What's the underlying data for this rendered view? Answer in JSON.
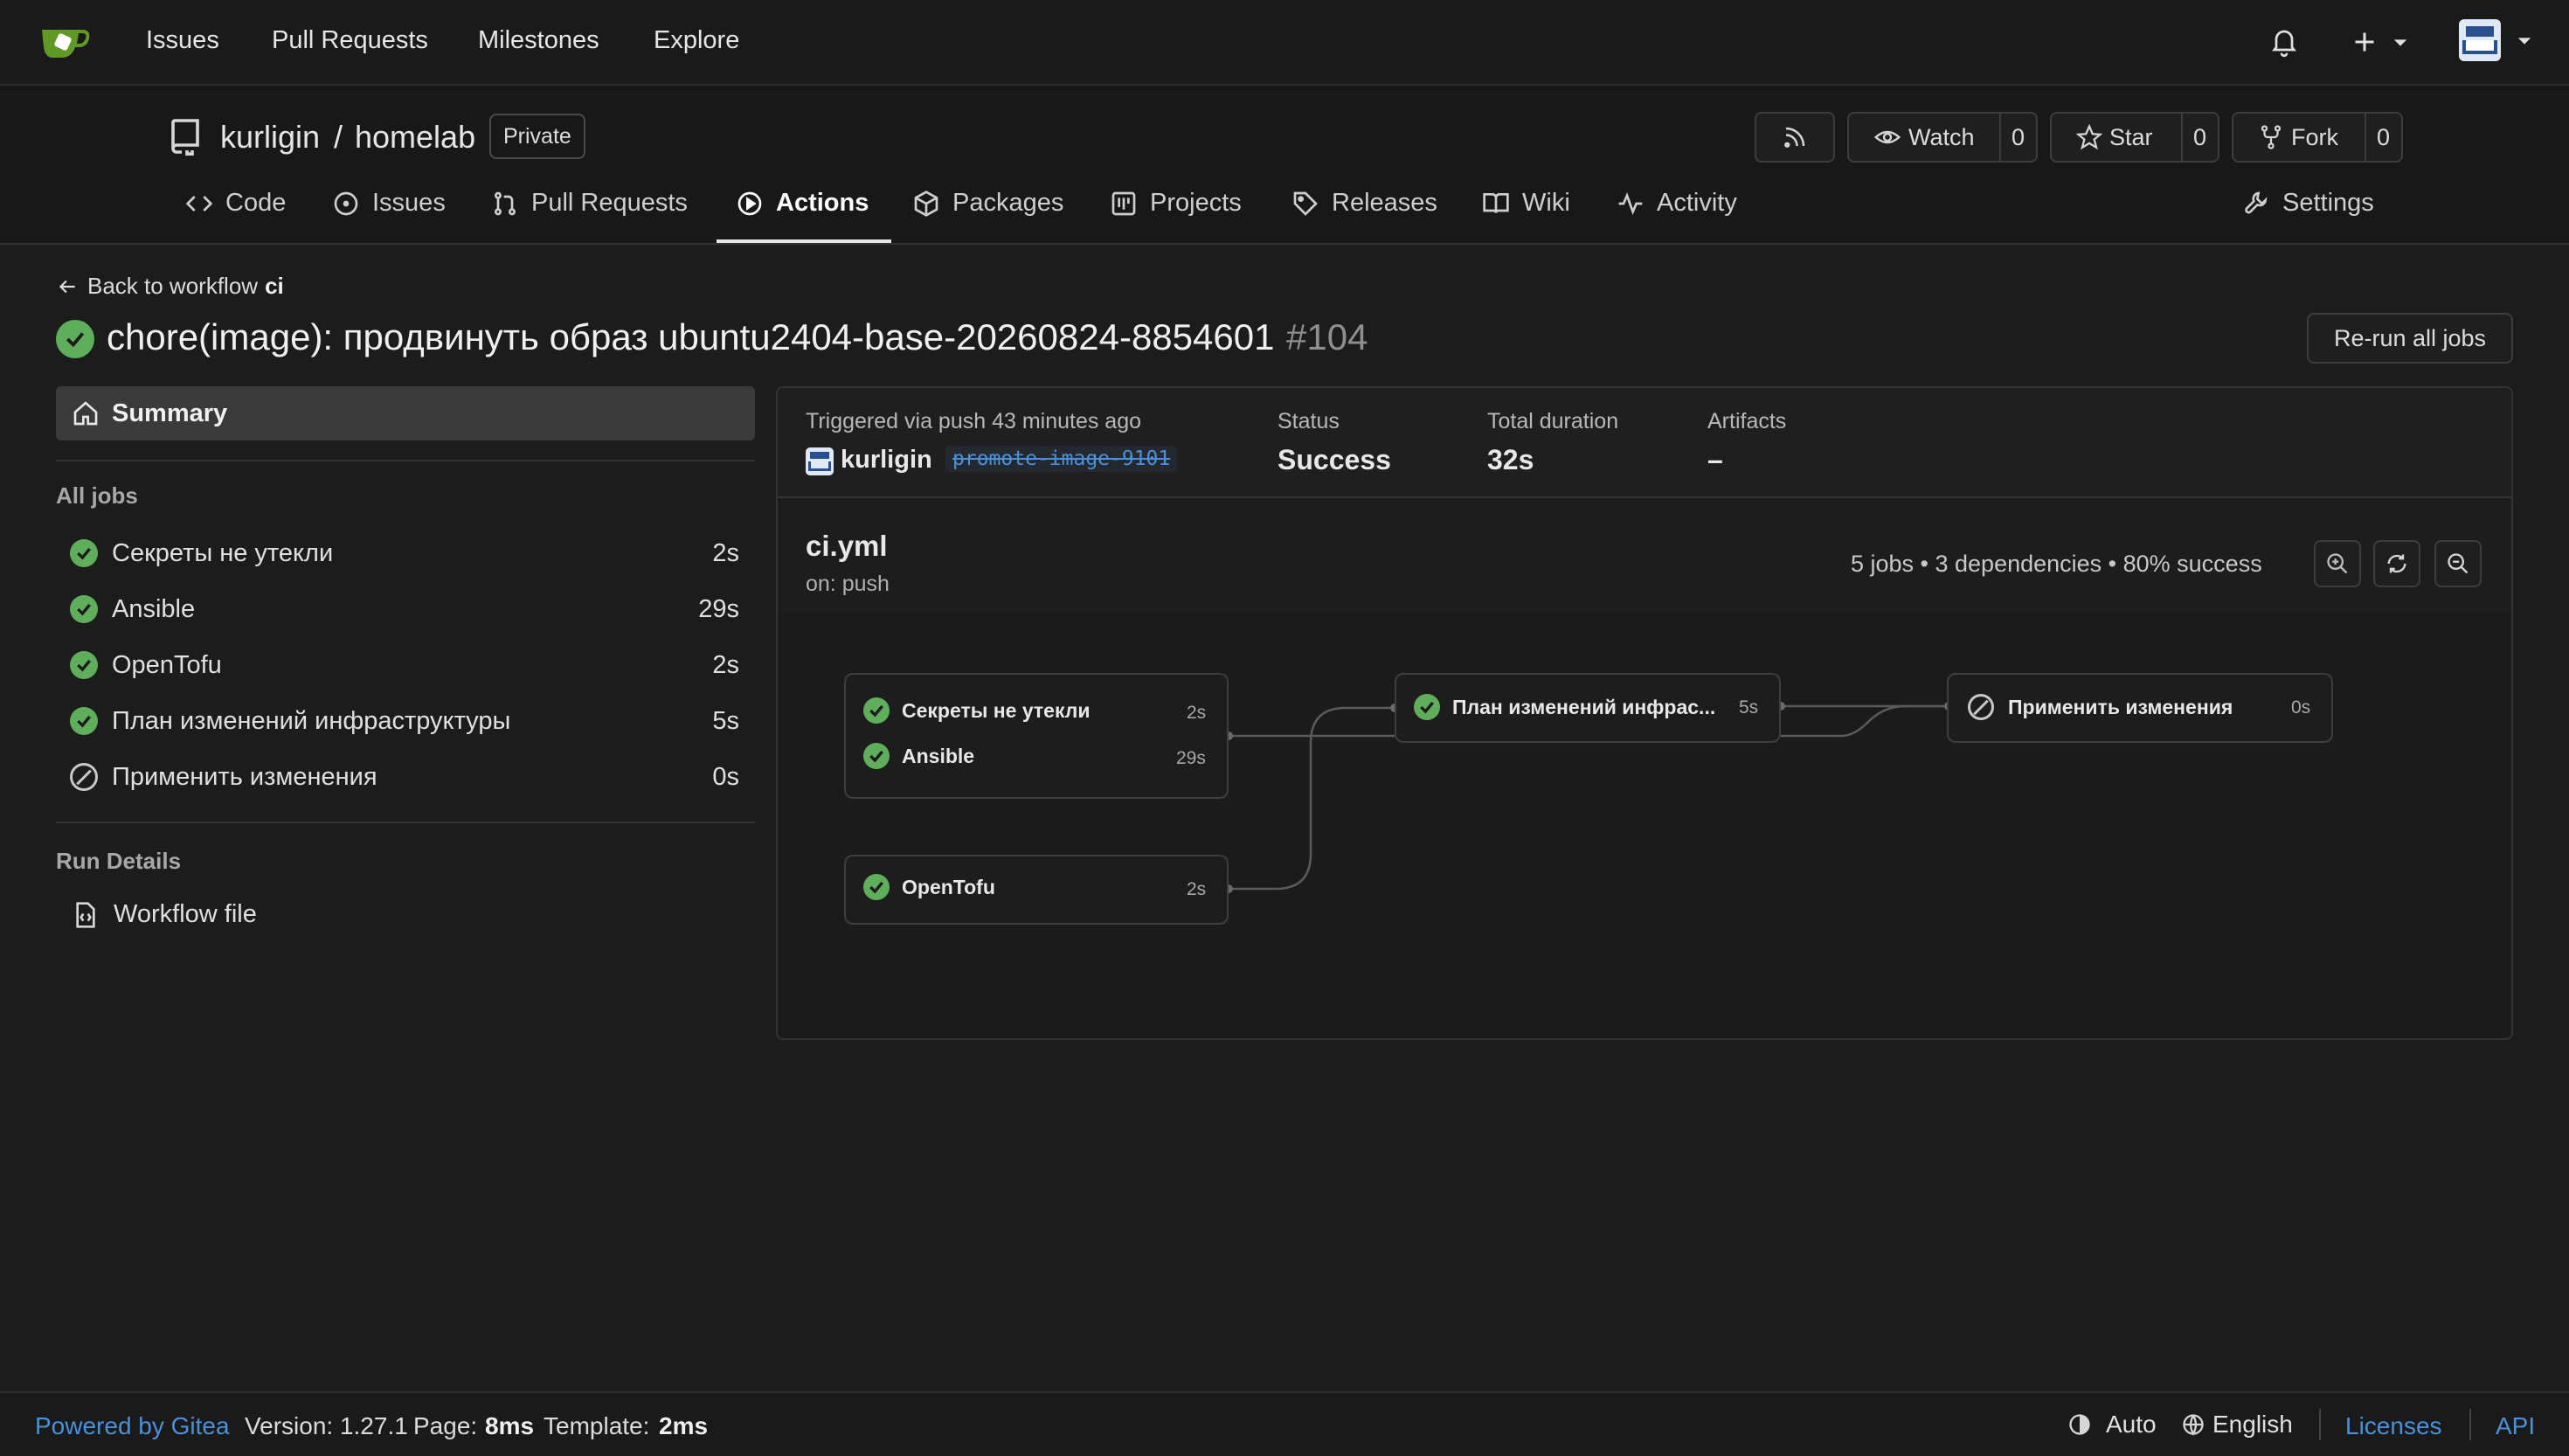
{
  "nav": {
    "items": [
      "Issues",
      "Pull Requests",
      "Milestones",
      "Explore"
    ]
  },
  "repo": {
    "owner": "kurligin",
    "separator": "/",
    "name": "homelab",
    "visibility": "Private",
    "watch_label": "Watch",
    "watch_count": "0",
    "star_label": "Star",
    "star_count": "0",
    "fork_label": "Fork",
    "fork_count": "0"
  },
  "tabs": {
    "code": "Code",
    "issues": "Issues",
    "pulls": "Pull Requests",
    "actions": "Actions",
    "packages": "Packages",
    "projects": "Projects",
    "releases": "Releases",
    "wiki": "Wiki",
    "activity": "Activity",
    "settings": "Settings"
  },
  "run": {
    "back_prefix": "Back to workflow",
    "back_workflow": "ci",
    "title": "chore(image): продвинуть образ ubuntu2404-base-20260824-8854601",
    "number": "#104",
    "rerun_label": "Re-run all jobs"
  },
  "sidebar": {
    "summary_label": "Summary",
    "all_jobs_label": "All jobs",
    "jobs": [
      {
        "name": "Секреты не утекли",
        "duration": "2s",
        "status": "success"
      },
      {
        "name": "Ansible",
        "duration": "29s",
        "status": "success"
      },
      {
        "name": "OpenTofu",
        "duration": "2s",
        "status": "success"
      },
      {
        "name": "План изменений инфраструктуры",
        "duration": "5s",
        "status": "success"
      },
      {
        "name": "Применить изменения",
        "duration": "0s",
        "status": "skipped"
      }
    ],
    "run_details_label": "Run Details",
    "workflow_file_label": "Workflow file"
  },
  "summary": {
    "triggered": "Triggered via push 43 minutes ago",
    "user": "kurligin",
    "branch": "promote-image-9101",
    "status_label": "Status",
    "status_value": "Success",
    "duration_label": "Total duration",
    "duration_value": "32s",
    "artifacts_label": "Artifacts",
    "artifacts_value": "–"
  },
  "workflow": {
    "file": "ci.yml",
    "on": "on: push",
    "stats": "5 jobs • 3 dependencies • 80% success"
  },
  "graph": {
    "node1_job1": "Секреты не утекли",
    "node1_job1_dur": "2s",
    "node1_job2": "Ansible",
    "node1_job2_dur": "29s",
    "node2_job": "OpenTofu",
    "node2_dur": "2s",
    "node3_job": "План изменений инфрас...",
    "node3_dur": "5s",
    "node4_job": "Применить изменения",
    "node4_dur": "0s"
  },
  "footer": {
    "powered": "Powered by Gitea",
    "version": "Version: 1.27.1",
    "page_prefix": "Page:",
    "page_time": "8ms",
    "template_prefix": "Template:",
    "template_time": "2ms",
    "theme": "Auto",
    "language": "English",
    "licenses": "Licenses",
    "api": "API"
  },
  "colors": {
    "success": "#5fae5b",
    "link": "#4b90d8",
    "background": "#1c1c1c"
  },
  "icons": [
    "gitea-logo-icon",
    "bell-icon",
    "plus-icon",
    "avatar",
    "rss-icon",
    "eye-icon",
    "star-icon",
    "fork-icon",
    "code-icon",
    "issue-icon",
    "pull-request-icon",
    "play-icon",
    "package-icon",
    "project-icon",
    "tag-icon",
    "book-icon",
    "pulse-icon",
    "tools-icon",
    "arrow-left-icon",
    "home-icon",
    "check-circle-icon",
    "skip-icon",
    "file-code-icon",
    "zoom-in-icon",
    "sync-icon",
    "zoom-out-icon",
    "theme-icon",
    "globe-icon"
  ]
}
